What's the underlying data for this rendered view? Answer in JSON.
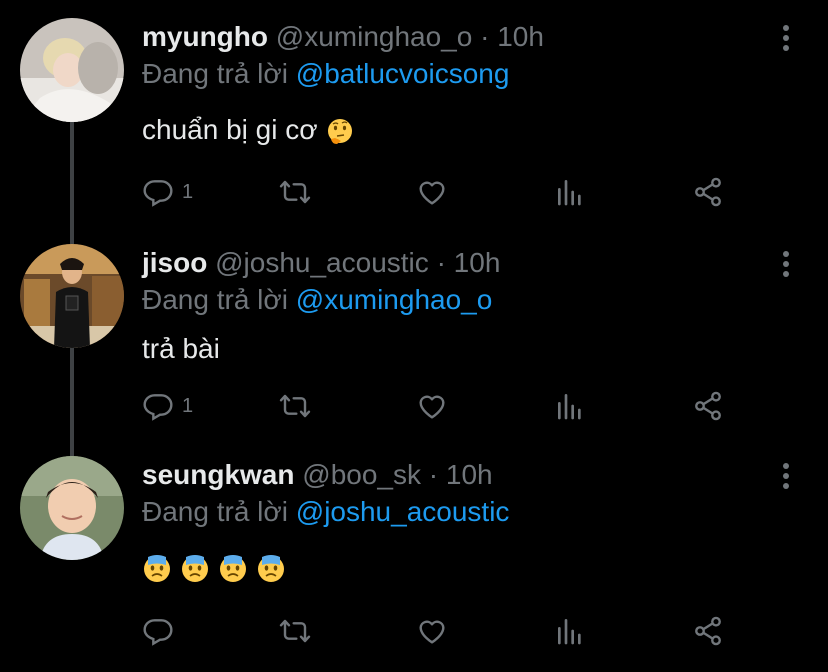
{
  "tweets": [
    {
      "name": "myungho",
      "handle": "@xuminghao_o",
      "dot": "·",
      "time": "10h",
      "reply_prefix": "Đang trả lời",
      "reply_to": "@batlucvoicsong",
      "text": "chuẩn bị gi cơ",
      "emoji": "thinking-face",
      "reply_count": "1"
    },
    {
      "name": "jisoo",
      "handle": "@joshu_acoustic",
      "dot": "·",
      "time": "10h",
      "reply_prefix": "Đang trả lời",
      "reply_to": "@xuminghao_o",
      "text": "trả bài",
      "reply_count": "1"
    },
    {
      "name": "seungkwan",
      "handle": "@boo_sk",
      "dot": "·",
      "time": "10h",
      "reply_prefix": "Đang trả lời",
      "reply_to": "@joshu_acoustic",
      "emojis": [
        "anxious-face",
        "anxious-face",
        "anxious-face",
        "anxious-face"
      ],
      "reply_count": ""
    }
  ],
  "colors": {
    "background": "#000000",
    "text": "#e7e9ea",
    "muted": "#71767b",
    "link": "#1d9bf0",
    "thread_line": "#3e4144"
  },
  "icons": [
    "reply-icon",
    "retweet-icon",
    "like-icon",
    "analytics-icon",
    "share-icon",
    "more-icon"
  ]
}
